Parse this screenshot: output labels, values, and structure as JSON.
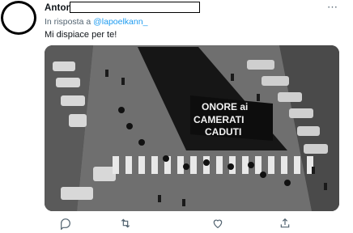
{
  "tweet": {
    "author_name": "Anton",
    "more_label": "⋯",
    "reply_prefix": "In risposta a",
    "reply_handle": "@lapoelkann_",
    "text": "Mi dispiace per te!"
  },
  "photo": {
    "banner_lines": [
      "ONORE ai",
      "CAMERATI",
      "CADUTI"
    ],
    "colorscheme": "grayscale"
  },
  "actions": [
    {
      "icon": "reply-icon"
    },
    {
      "icon": "retweet-icon"
    },
    {
      "icon": "like-icon"
    },
    {
      "icon": "share-icon"
    }
  ],
  "colors": {
    "link": "#1d9bf0",
    "secondary_text": "#536471"
  }
}
